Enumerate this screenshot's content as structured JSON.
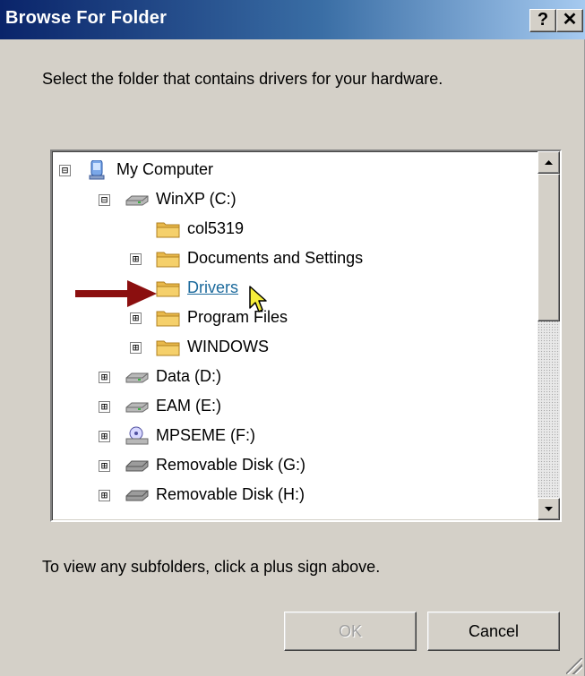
{
  "window": {
    "title": "Browse For Folder",
    "help_button": "?",
    "close_button": "✕"
  },
  "instruction": "Select the folder that contains drivers for your hardware.",
  "tree": [
    {
      "label": "My Computer",
      "icon": "my-computer-icon",
      "expander": "⊟",
      "selected": false
    },
    {
      "label": "WinXP (C:)",
      "icon": "hard-drive-icon",
      "expander": "⊟",
      "selected": false
    },
    {
      "label": "col5319",
      "icon": "folder-icon",
      "expander": "",
      "selected": false
    },
    {
      "label": "Documents and Settings",
      "icon": "folder-icon",
      "expander": "⊞",
      "selected": false
    },
    {
      "label": "Drivers",
      "icon": "folder-icon",
      "expander": "",
      "selected": true
    },
    {
      "label": "Program Files",
      "icon": "folder-icon",
      "expander": "⊞",
      "selected": false
    },
    {
      "label": "WINDOWS",
      "icon": "folder-icon",
      "expander": "⊞",
      "selected": false
    },
    {
      "label": "Data (D:)",
      "icon": "hard-drive-icon",
      "expander": "⊞",
      "selected": false
    },
    {
      "label": "EAM (E:)",
      "icon": "hard-drive-icon",
      "expander": "⊞",
      "selected": false
    },
    {
      "label": "MPSEME (F:)",
      "icon": "network-drive-icon",
      "expander": "⊞",
      "selected": false
    },
    {
      "label": "Removable Disk (G:)",
      "icon": "removable-disk-icon",
      "expander": "⊞",
      "selected": false
    },
    {
      "label": "Removable Disk (H:)",
      "icon": "removable-disk-icon",
      "expander": "⊞",
      "selected": false
    }
  ],
  "hint": "To view any subfolders, click a plus sign above.",
  "buttons": {
    "ok": "OK",
    "cancel": "Cancel"
  },
  "colors": {
    "title_start": "#0a246a",
    "title_end": "#a6caf0",
    "dialog_bg": "#d4d0c8",
    "selected_link": "#1c6a9c",
    "pointer_arrow": "#8b0f0f",
    "folder": "#f5d06b"
  }
}
